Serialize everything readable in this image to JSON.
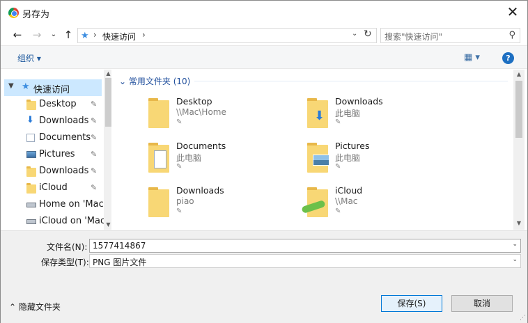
{
  "window": {
    "title": "另存为",
    "close_glyph": "✕",
    "icon": "chrome-icon"
  },
  "nav": {
    "back_glyph": "←",
    "forward_glyph": "→",
    "dropdown_glyph": "⌄",
    "up_glyph": "↑",
    "address_sep": "›",
    "address_text": "快速访问",
    "refresh_glyph": "↻",
    "search_placeholder": "搜索\"快速访问\"",
    "search_glyph": "⚲"
  },
  "toolbar": {
    "organize_label": "组织 ▾",
    "view_glyph": "▦ ▾",
    "help_glyph": "?"
  },
  "sidebar": {
    "root": {
      "label": "快速访问",
      "expanded": true
    },
    "items": [
      {
        "label": "Desktop",
        "icon": "folder-icon",
        "pinned": true
      },
      {
        "label": "Downloads",
        "icon": "download-icon",
        "pinned": true
      },
      {
        "label": "Documents",
        "icon": "documents-icon",
        "pinned": true
      },
      {
        "label": "Pictures",
        "icon": "pictures-icon",
        "pinned": true
      },
      {
        "label": "Downloads",
        "icon": "folder-icon",
        "pinned": true
      },
      {
        "label": "iCloud",
        "icon": "icloud-folder-icon",
        "pinned": true
      },
      {
        "label": "Home on 'Mac'",
        "icon": "network-drive-icon",
        "pinned": false
      },
      {
        "label": "iCloud on 'Mac'",
        "icon": "network-drive-icon",
        "pinned": false
      }
    ],
    "pin_glyph": "📌"
  },
  "content": {
    "group_title": "常用文件夹 (10)",
    "group_chevron": "⌄",
    "tiles": [
      {
        "name": "Desktop",
        "location": "\\\\Mac\\Home",
        "icon": "folder-icon"
      },
      {
        "name": "Downloads",
        "location": "此电脑",
        "icon": "downloads-folder-icon"
      },
      {
        "name": "Documents",
        "location": "此电脑",
        "icon": "documents-folder-icon"
      },
      {
        "name": "Pictures",
        "location": "此电脑",
        "icon": "pictures-folder-icon"
      },
      {
        "name": "Downloads",
        "location": "piao",
        "icon": "folder-icon"
      },
      {
        "name": "iCloud",
        "location": "\\\\Mac",
        "icon": "network-folder-icon"
      }
    ]
  },
  "fields": {
    "filename_label": "文件名(N):",
    "filename_value": "1577414867",
    "filetype_label": "保存类型(T):",
    "filetype_value": "PNG 图片文件"
  },
  "footer": {
    "hide_folders_label": "隐藏文件夹",
    "hide_folders_glyph": "⌃",
    "save_label": "保存(S)",
    "cancel_label": "取消",
    "grip_glyph": "⋰"
  },
  "colors": {
    "accent": "#0078d7",
    "selection": "#cce8ff",
    "folder": "#f8d775",
    "link": "#1f4e9c"
  }
}
